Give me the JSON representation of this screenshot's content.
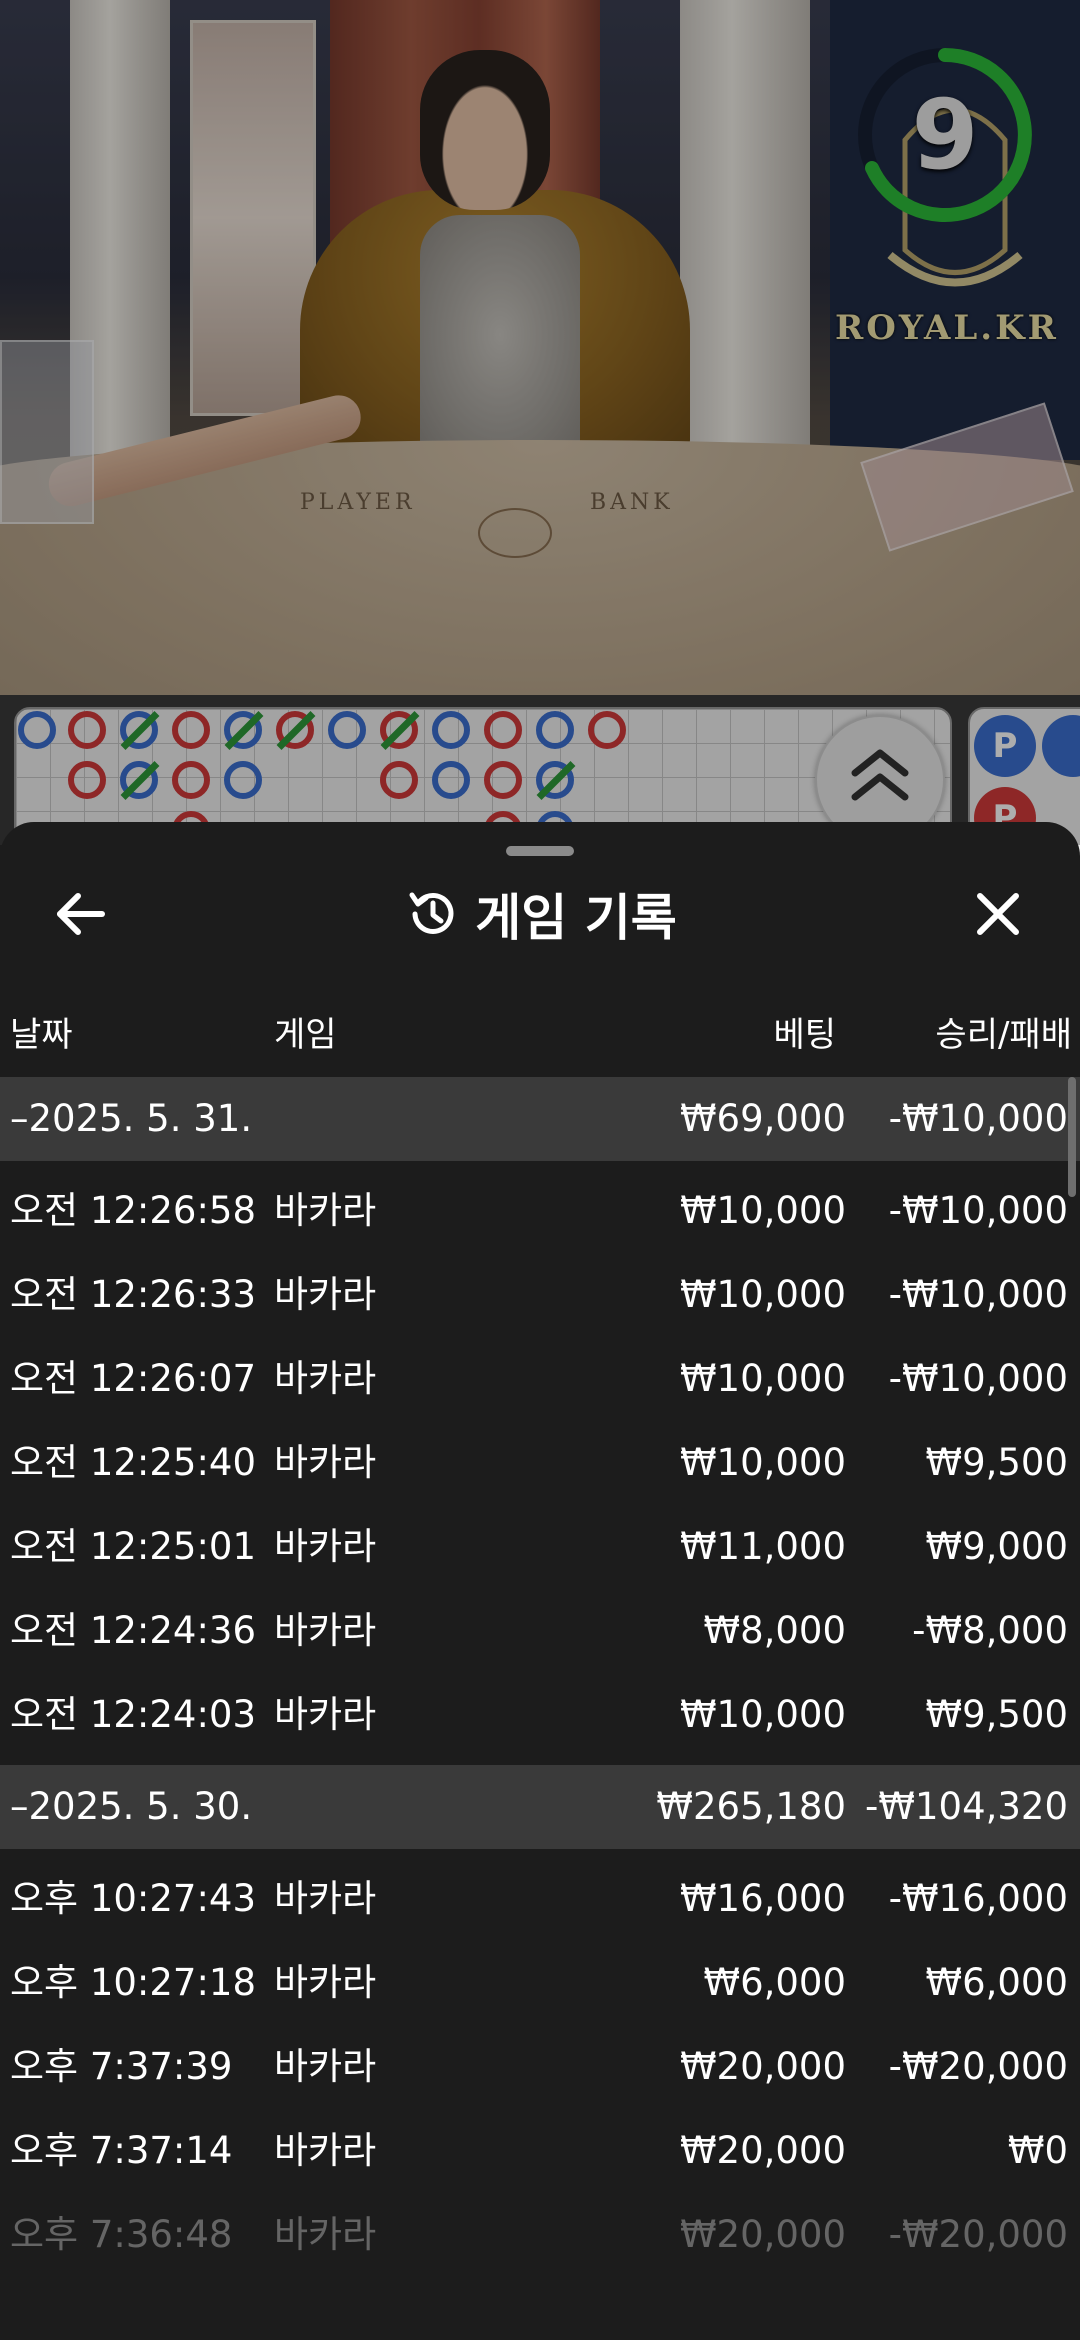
{
  "stream": {
    "timer_value": "9",
    "brand_text": "ROYAL.KR",
    "table_left_word": "PLAYER",
    "table_right_word": "BANK"
  },
  "roadmap": {
    "chips": [
      "P",
      "P"
    ]
  },
  "sheet": {
    "title": "게임 기록",
    "columns": {
      "date": "날짜",
      "game": "게임",
      "bet": "베팅",
      "result": "승리/패배"
    },
    "days": [
      {
        "date": "–2025. 5. 31.",
        "bet_total": "₩69,000",
        "result_total": "-₩10,000",
        "rows": [
          {
            "time": "오전 12:26:58",
            "game": "바카라",
            "bet": "₩10,000",
            "result": "-₩10,000"
          },
          {
            "time": "오전 12:26:33",
            "game": "바카라",
            "bet": "₩10,000",
            "result": "-₩10,000"
          },
          {
            "time": "오전 12:26:07",
            "game": "바카라",
            "bet": "₩10,000",
            "result": "-₩10,000"
          },
          {
            "time": "오전 12:25:40",
            "game": "바카라",
            "bet": "₩10,000",
            "result": "₩9,500"
          },
          {
            "time": "오전 12:25:01",
            "game": "바카라",
            "bet": "₩11,000",
            "result": "₩9,000"
          },
          {
            "time": "오전 12:24:36",
            "game": "바카라",
            "bet": "₩8,000",
            "result": "-₩8,000"
          },
          {
            "time": "오전 12:24:03",
            "game": "바카라",
            "bet": "₩10,000",
            "result": "₩9,500"
          }
        ]
      },
      {
        "date": "–2025. 5. 30.",
        "bet_total": "₩265,180",
        "result_total": "-₩104,320",
        "rows": [
          {
            "time": "오후 10:27:43",
            "game": "바카라",
            "bet": "₩16,000",
            "result": "-₩16,000"
          },
          {
            "time": "오후 10:27:18",
            "game": "바카라",
            "bet": "₩6,000",
            "result": "₩6,000"
          },
          {
            "time": "오후 7:37:39",
            "game": "바카라",
            "bet": "₩20,000",
            "result": "-₩20,000"
          },
          {
            "time": "오후 7:37:14",
            "game": "바카라",
            "bet": "₩20,000",
            "result": "₩0"
          },
          {
            "time": "오후 7:36:48",
            "game": "바카라",
            "bet": "₩20,000",
            "result": "-₩20,000"
          }
        ]
      }
    ]
  }
}
